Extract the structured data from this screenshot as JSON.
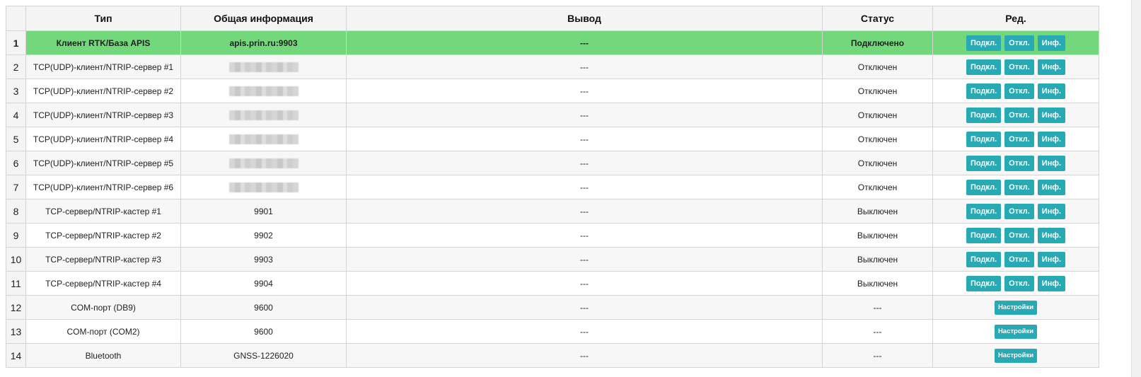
{
  "headers": {
    "type": "Тип",
    "info": "Общая информация",
    "output": "Вывод",
    "status": "Статус",
    "edit": "Ред."
  },
  "buttons": {
    "connect": "Подкл.",
    "disconnect": "Откл.",
    "info": "Инф.",
    "settings": "Настройки"
  },
  "colors": {
    "active_row": "#72d87b",
    "button": "#27aab4"
  },
  "rows": [
    {
      "idx": "1",
      "type": "Клиент RTK/База APIS",
      "info": "apis.prin.ru:9903",
      "output": "---",
      "status": "Подключено"
    },
    {
      "idx": "2",
      "type": "TCP(UDP)-клиент/NTRIP-сервер #1",
      "info": "",
      "output": "---",
      "status": "Отключен"
    },
    {
      "idx": "3",
      "type": "TCP(UDP)-клиент/NTRIP-сервер #2",
      "info": "",
      "output": "---",
      "status": "Отключен"
    },
    {
      "idx": "4",
      "type": "TCP(UDP)-клиент/NTRIP-сервер #3",
      "info": "",
      "output": "---",
      "status": "Отключен"
    },
    {
      "idx": "5",
      "type": "TCP(UDP)-клиент/NTRIP-сервер #4",
      "info": "",
      "output": "---",
      "status": "Отключен"
    },
    {
      "idx": "6",
      "type": "TCP(UDP)-клиент/NTRIP-сервер #5",
      "info": "",
      "output": "---",
      "status": "Отключен"
    },
    {
      "idx": "7",
      "type": "TCP(UDP)-клиент/NTRIP-сервер #6",
      "info": "",
      "output": "---",
      "status": "Отключен"
    },
    {
      "idx": "8",
      "type": "TCP-сервер/NTRIP-кастер #1",
      "info": "9901",
      "output": "---",
      "status": "Выключен"
    },
    {
      "idx": "9",
      "type": "TCP-сервер/NTRIP-кастер #2",
      "info": "9902",
      "output": "---",
      "status": "Выключен"
    },
    {
      "idx": "10",
      "type": "TCP-сервер/NTRIP-кастер #3",
      "info": "9903",
      "output": "---",
      "status": "Выключен"
    },
    {
      "idx": "11",
      "type": "TCP-сервер/NTRIP-кастер #4",
      "info": "9904",
      "output": "---",
      "status": "Выключен"
    },
    {
      "idx": "12",
      "type": "COM-порт (DB9)",
      "info": "9600",
      "output": "---",
      "status": "---"
    },
    {
      "idx": "13",
      "type": "COM-порт (COM2)",
      "info": "9600",
      "output": "---",
      "status": "---"
    },
    {
      "idx": "14",
      "type": "Bluetooth",
      "info": "GNSS-1226020",
      "output": "---",
      "status": "---"
    }
  ]
}
